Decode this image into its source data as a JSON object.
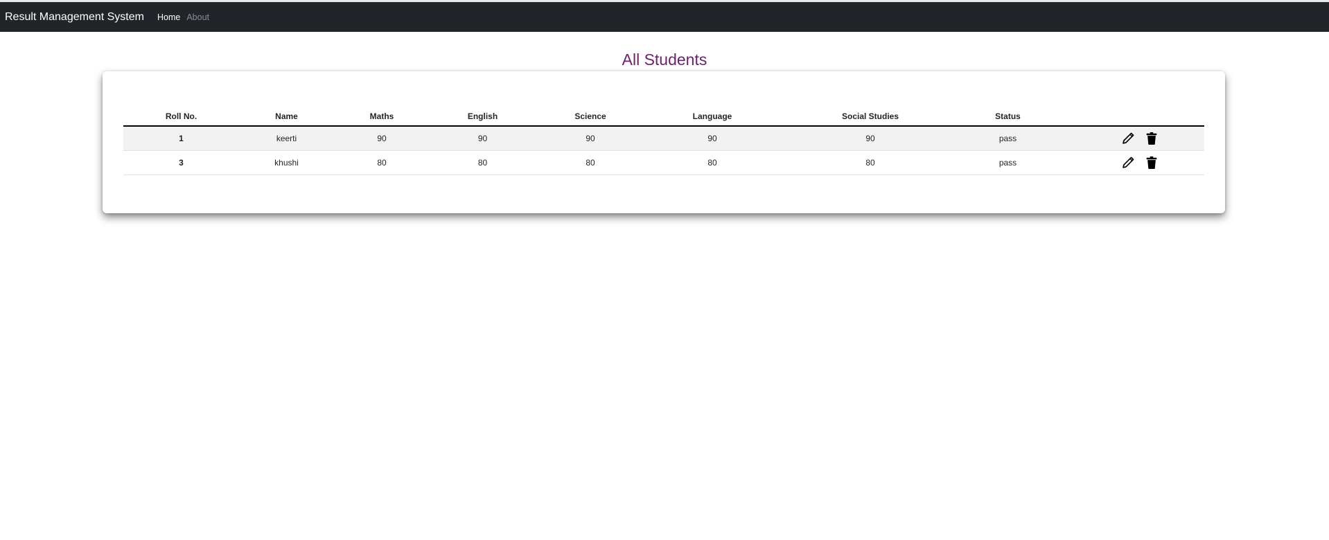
{
  "navbar": {
    "brand": "Result Management System",
    "links": [
      {
        "label": "Home",
        "active": true
      },
      {
        "label": "About",
        "active": false
      }
    ],
    "bg_color": "#212529"
  },
  "page": {
    "title": "All Students",
    "title_color": "#6d1f6f"
  },
  "table": {
    "columns": [
      "Roll No.",
      "Name",
      "Maths",
      "English",
      "Science",
      "Language",
      "Social Studies",
      "Status",
      ""
    ],
    "rows": [
      {
        "roll": "1",
        "name": "keerti",
        "maths": "90",
        "english": "90",
        "science": "90",
        "language": "90",
        "social": "90",
        "status": "pass",
        "actions": [
          "edit-icon",
          "delete-icon"
        ]
      },
      {
        "roll": "3",
        "name": "khushi",
        "maths": "80",
        "english": "80",
        "science": "80",
        "language": "80",
        "social": "80",
        "status": "pass",
        "actions": [
          "edit-icon",
          "delete-icon"
        ]
      }
    ]
  }
}
